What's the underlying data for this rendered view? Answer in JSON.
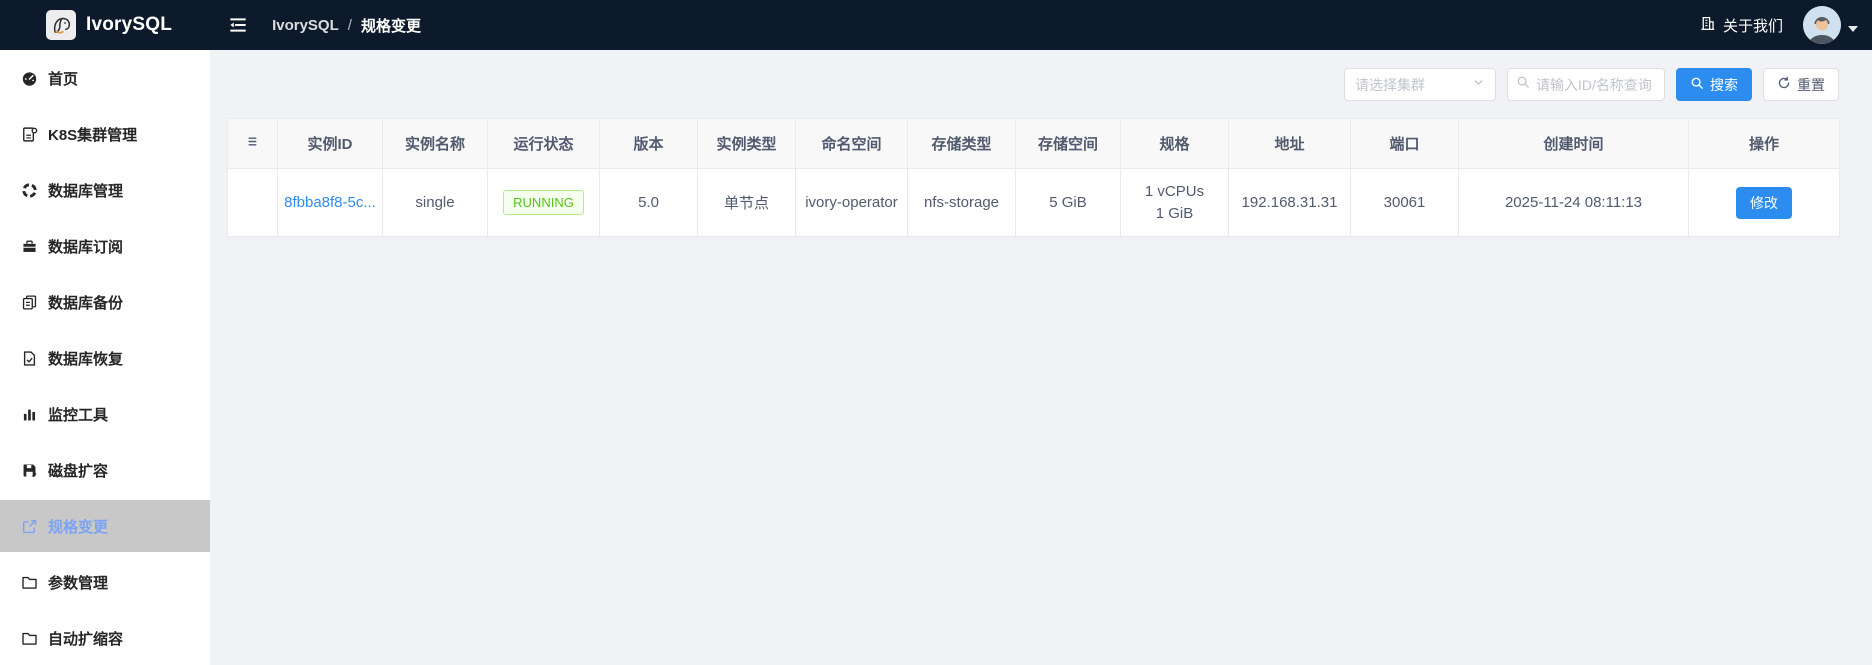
{
  "topbar": {
    "brand": "IvorySQL",
    "breadcrumb": [
      "IvorySQL",
      "规格变更"
    ],
    "breadcrumb_separator": "/",
    "about_label": "关于我们"
  },
  "sidebar": {
    "items": [
      {
        "label": "首页",
        "icon": "dashboard-icon",
        "active": false
      },
      {
        "label": "K8S集群管理",
        "icon": "cluster-icon",
        "active": false
      },
      {
        "label": "数据库管理",
        "icon": "database-manage-icon",
        "active": false
      },
      {
        "label": "数据库订阅",
        "icon": "subscribe-icon",
        "active": false
      },
      {
        "label": "数据库备份",
        "icon": "backup-icon",
        "active": false
      },
      {
        "label": "数据库恢复",
        "icon": "restore-icon",
        "active": false
      },
      {
        "label": "监控工具",
        "icon": "monitor-icon",
        "active": false
      },
      {
        "label": "磁盘扩容",
        "icon": "disk-icon",
        "active": false
      },
      {
        "label": "规格变更",
        "icon": "spec-change-icon",
        "active": true
      },
      {
        "label": "参数管理",
        "icon": "folder-icon",
        "active": false
      },
      {
        "label": "自动扩缩容",
        "icon": "folder-icon",
        "active": false
      }
    ]
  },
  "filters": {
    "cluster_placeholder": "请选择集群",
    "search_placeholder": "请输入ID/名称查询",
    "search_label": "搜索",
    "reset_label": "重置"
  },
  "table": {
    "headers": [
      "实例ID",
      "实例名称",
      "运行状态",
      "版本",
      "实例类型",
      "命名空间",
      "存储类型",
      "存储空间",
      "规格",
      "地址",
      "端口",
      "创建时间",
      "操作"
    ],
    "rows": [
      {
        "instance_id": "8fbba8f8-5c...",
        "name": "single",
        "status": "RUNNING",
        "version": "5.0",
        "type": "单节点",
        "namespace": "ivory-operator",
        "storage_type": "nfs-storage",
        "storage_size": "5 GiB",
        "spec": [
          "1 vCPUs",
          "1 GiB"
        ],
        "address": "192.168.31.31",
        "port": "30061",
        "created": "2025-11-24 08:11:13",
        "action_label": "修改"
      }
    ]
  },
  "colors": {
    "primary": "#2d8cf0",
    "status_running": "#52c41a",
    "topbar_bg": "#0c1a2c",
    "active_item_text": "#7ea3f3"
  }
}
